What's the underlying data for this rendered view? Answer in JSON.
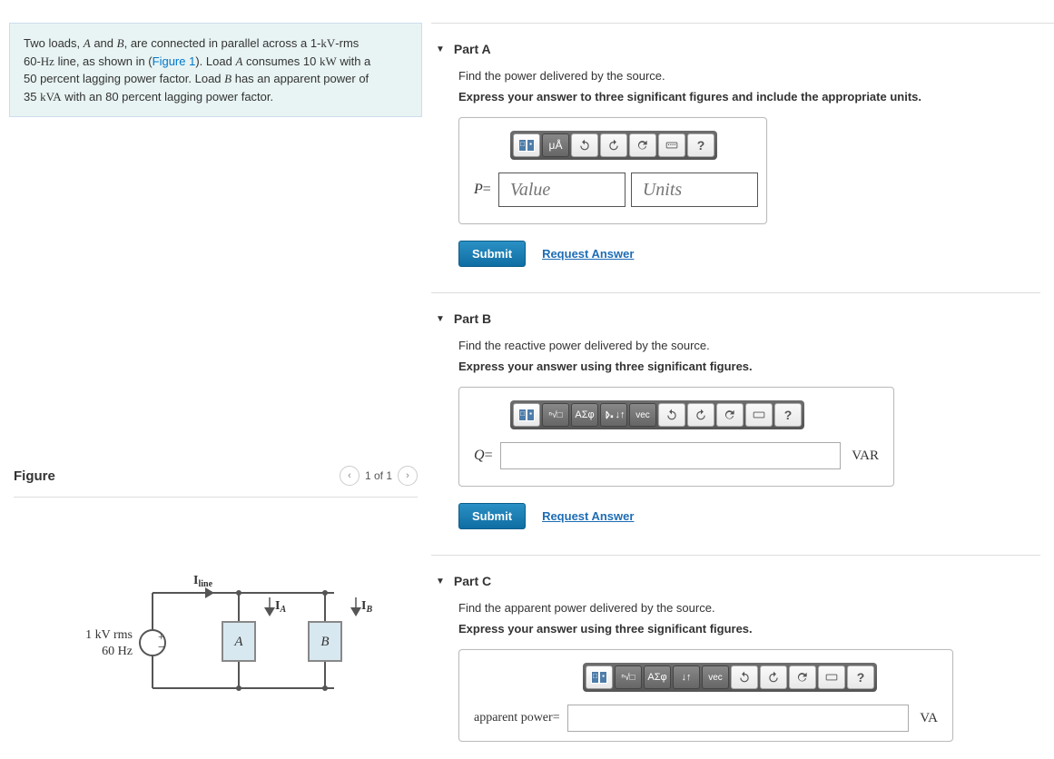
{
  "problem": {
    "line1_a": "Two loads, ",
    "line1_b": " and ",
    "line1_c": ", are connected in parallel across a 1-",
    "line1_d": "-rms",
    "line2_a": "60-",
    "line2_b": " line, as shown in (",
    "figure_link": "Figure 1",
    "line2_c": "). Load ",
    "line2_d": " consumes 10 ",
    "line2_e": " with a",
    "line3": "50 percent lagging power factor. Load ",
    "line3_b": " has an apparent power of",
    "line4_a": "35 ",
    "line4_b": " with an 80 percent lagging power factor.",
    "A": "A",
    "B": "B",
    "kV": "kV",
    "Hz": "Hz",
    "kW": "kW",
    "kVA": "kVA"
  },
  "figure": {
    "title": "Figure",
    "counter": "1 of 1",
    "source_label_top": "1 kV rms",
    "source_label_bot": "60 Hz",
    "Iline": "I",
    "Iline_sub": "line",
    "IA": "I",
    "IA_sub": "A",
    "IB": "I",
    "IB_sub": "B",
    "boxA": "A",
    "boxB": "B"
  },
  "parts": {
    "A": {
      "title": "Part A",
      "question": "Find the power delivered by the source.",
      "instruction": "Express your answer to three significant figures and include the appropriate units.",
      "var": "P",
      "value_ph": "Value",
      "units_ph": "Units",
      "mu_label": "μÅ"
    },
    "B": {
      "title": "Part B",
      "question": "Find the reactive power delivered by the source.",
      "instruction": "Express your answer using three significant figures.",
      "var": "Q",
      "unit_suffix": "VAR",
      "greek": "ΑΣφ",
      "vec": "vec"
    },
    "C": {
      "title": "Part C",
      "question": "Find the apparent power delivered by the source.",
      "instruction": "Express your answer using three significant figures.",
      "var_label": "apparent power",
      "unit_suffix": "VA",
      "greek": "ΑΣφ",
      "vec": "vec"
    }
  },
  "buttons": {
    "submit": "Submit",
    "request": "Request Answer"
  }
}
